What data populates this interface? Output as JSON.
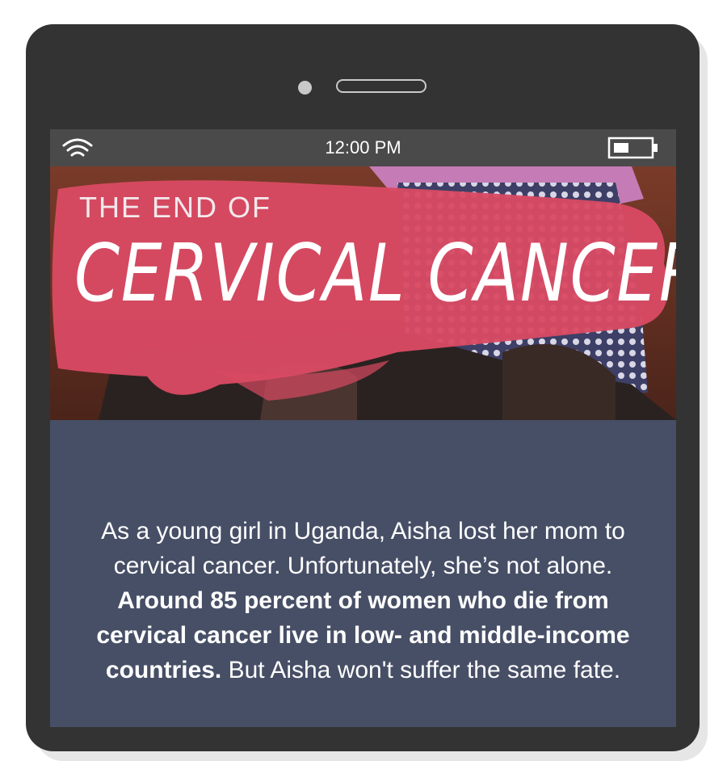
{
  "status_bar": {
    "time": "12:00 PM",
    "wifi_icon": "wifi-icon",
    "battery_icon": "battery-icon"
  },
  "hero": {
    "kicker": "THE END OF",
    "headline": "CERVICAL CANCER",
    "image": "photo of a girl sitting, with pink brush stroke banner",
    "colors": {
      "brush": "#d84a63",
      "background_earth": "#6b3526"
    }
  },
  "story": {
    "part1": "As a young girl in Uganda, Aisha lost her mom to cervical cancer. Unfortunately, she’s not alone. ",
    "part2_bold": "Around 85 percent of women who die from cervical cancer live in low- and middle-income countries.",
    "part3": " But Aisha won't suffer the same fate."
  },
  "colors": {
    "phone_body": "#333333",
    "status_bar": "#4a4a4a",
    "content_bg": "#474f66"
  }
}
